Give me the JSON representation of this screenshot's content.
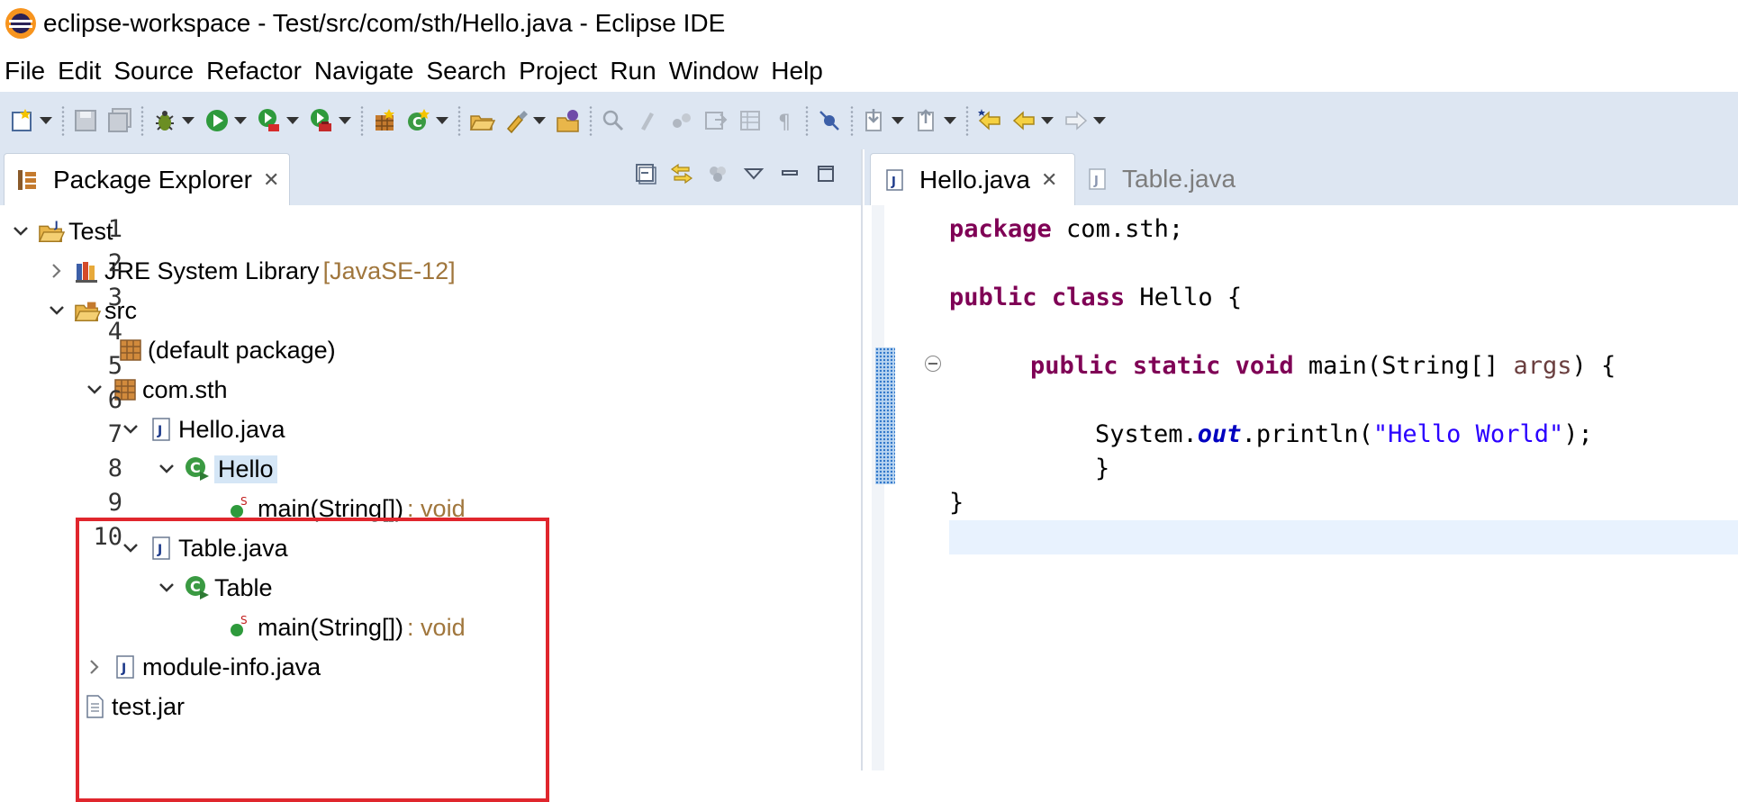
{
  "window": {
    "title": "eclipse-workspace - Test/src/com/sth/Hello.java - Eclipse IDE"
  },
  "menu": [
    "File",
    "Edit",
    "Source",
    "Refactor",
    "Navigate",
    "Search",
    "Project",
    "Run",
    "Window",
    "Help"
  ],
  "package_explorer": {
    "tab_label": "Package Explorer",
    "tree": [
      {
        "label": "Test",
        "decoration": ""
      },
      {
        "label": "JRE System Library",
        "decoration": "[JavaSE-12]"
      },
      {
        "label": "src",
        "decoration": ""
      },
      {
        "label": "(default package)",
        "decoration": ""
      },
      {
        "label": "com.sth",
        "decoration": ""
      },
      {
        "label": "Hello.java",
        "decoration": ""
      },
      {
        "label": "Hello",
        "decoration": ""
      },
      {
        "label": "main(String[])",
        "decoration": ": void"
      },
      {
        "label": "Table.java",
        "decoration": ""
      },
      {
        "label": "Table",
        "decoration": ""
      },
      {
        "label": "main(String[])",
        "decoration": ": void"
      },
      {
        "label": "module-info.java",
        "decoration": ""
      },
      {
        "label": "test.jar",
        "decoration": ""
      }
    ]
  },
  "editor": {
    "tabs": [
      {
        "label": "Hello.java",
        "active": true
      },
      {
        "label": "Table.java",
        "active": false
      }
    ],
    "line_numbers": [
      "1",
      "2",
      "3",
      "4",
      "5",
      "6",
      "7",
      "8",
      "9",
      "10"
    ],
    "code": {
      "l1_kw": "package",
      "l1_rest": " com.sth;",
      "l3_kw1": "public",
      "l3_kw2": "class",
      "l3_rest": " Hello {",
      "l5_kw1": "public",
      "l5_kw2": "static",
      "l5_kw3": "void",
      "l5_mid": " main(String[] ",
      "l5_param": "args",
      "l5_end": ") {",
      "l7_pre": "System.",
      "l7_field": "out",
      "l7_mid": ".println(",
      "l7_str": "\"Hello World\"",
      "l7_end": ");",
      "l8": "}",
      "l9": "}"
    }
  }
}
